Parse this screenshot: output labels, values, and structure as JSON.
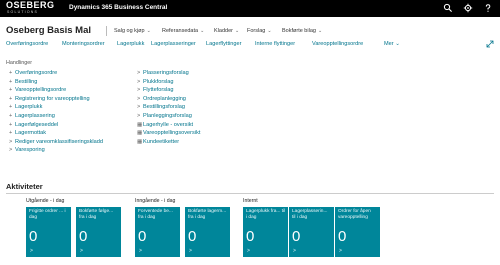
{
  "topbar": {
    "logo_main": "OSEBERG",
    "logo_sub": "SOLUTIONS",
    "app_title": "Dynamics 365 Business Central"
  },
  "header": {
    "company": "Oseberg Basis Mal",
    "menus": [
      "Salg og kjøp",
      "Referansedata",
      "Kladder",
      "Forslag",
      "Bokførte bilag"
    ]
  },
  "actions": [
    "Overføringsordre",
    "Monteringsordrer",
    "Lagerplukk",
    "Lagerplasseringer",
    "Lagerflyttinger",
    "Interne flyttinger",
    "Vareopptellingsordre",
    "Mer"
  ],
  "handlinger": {
    "label": "Handlinger",
    "col1": [
      {
        "sym": "+",
        "text": "Overføringsordre"
      },
      {
        "sym": "+",
        "text": "Bestilling"
      },
      {
        "sym": "+",
        "text": "Vareopptellingsordre"
      },
      {
        "sym": "+",
        "text": "Registrering for vareopptelling"
      },
      {
        "sym": "+",
        "text": "Lagerplukk"
      },
      {
        "sym": "+",
        "text": "Lagerplassering"
      },
      {
        "sym": "+",
        "text": "Lagerfølgeseddel"
      },
      {
        "sym": "+",
        "text": "Lagermottak"
      },
      {
        "sym": ">",
        "text": "Rediger vareomklassifiseringskladd"
      },
      {
        "sym": ">",
        "text": "Varesporing"
      }
    ],
    "col2": [
      {
        "sym": ">",
        "text": "Plasseringsforslag"
      },
      {
        "sym": ">",
        "text": "Plukkforslag"
      },
      {
        "sym": ">",
        "text": "Flytteforslag"
      },
      {
        "sym": ">",
        "text": "Ordreplanlegging"
      },
      {
        "sym": ">",
        "text": "Bestillingsforslag"
      },
      {
        "sym": ">",
        "text": "Planleggingsforslag"
      },
      {
        "sym": "▦",
        "text": "Lagerhylle - oversikt"
      },
      {
        "sym": "▦",
        "text": "Vareopptellingsoversikt"
      },
      {
        "sym": "▦",
        "text": "Kundeetiketter"
      }
    ]
  },
  "aktiviteter": {
    "title": "Aktiviteter",
    "groups": [
      {
        "label": "Utgående - i dag",
        "tiles": [
          {
            "label": "Frigitte ordrer ... i dag",
            "value": "0",
            "chev": ">"
          },
          {
            "label": "Bokførte følge... fra i dag",
            "value": "0",
            "chev": ">"
          }
        ]
      },
      {
        "label": "Inngående - i dag",
        "tiles": [
          {
            "label": "Forventede be... fra i dag",
            "value": "0",
            "chev": ">"
          },
          {
            "label": "Bokførte lagerm... fra i dag",
            "value": "0",
            "chev": ">"
          }
        ]
      },
      {
        "label": "Internt",
        "tiles": [
          {
            "label": "Lagerplukk fra... til i dag",
            "value": "0",
            "chev": ">"
          },
          {
            "label": "Lagerplasserin... til i dag",
            "value": "0",
            "chev": ">"
          },
          {
            "label": "Ordrer for åpen vareopptelling",
            "value": "0",
            "chev": ">"
          }
        ]
      }
    ]
  },
  "colors": {
    "accent": "#00748c",
    "tile": "#00869a",
    "topbar": "#000000"
  },
  "icons": [
    "search-icon",
    "settings-icon",
    "help-icon",
    "expand-icon"
  ]
}
